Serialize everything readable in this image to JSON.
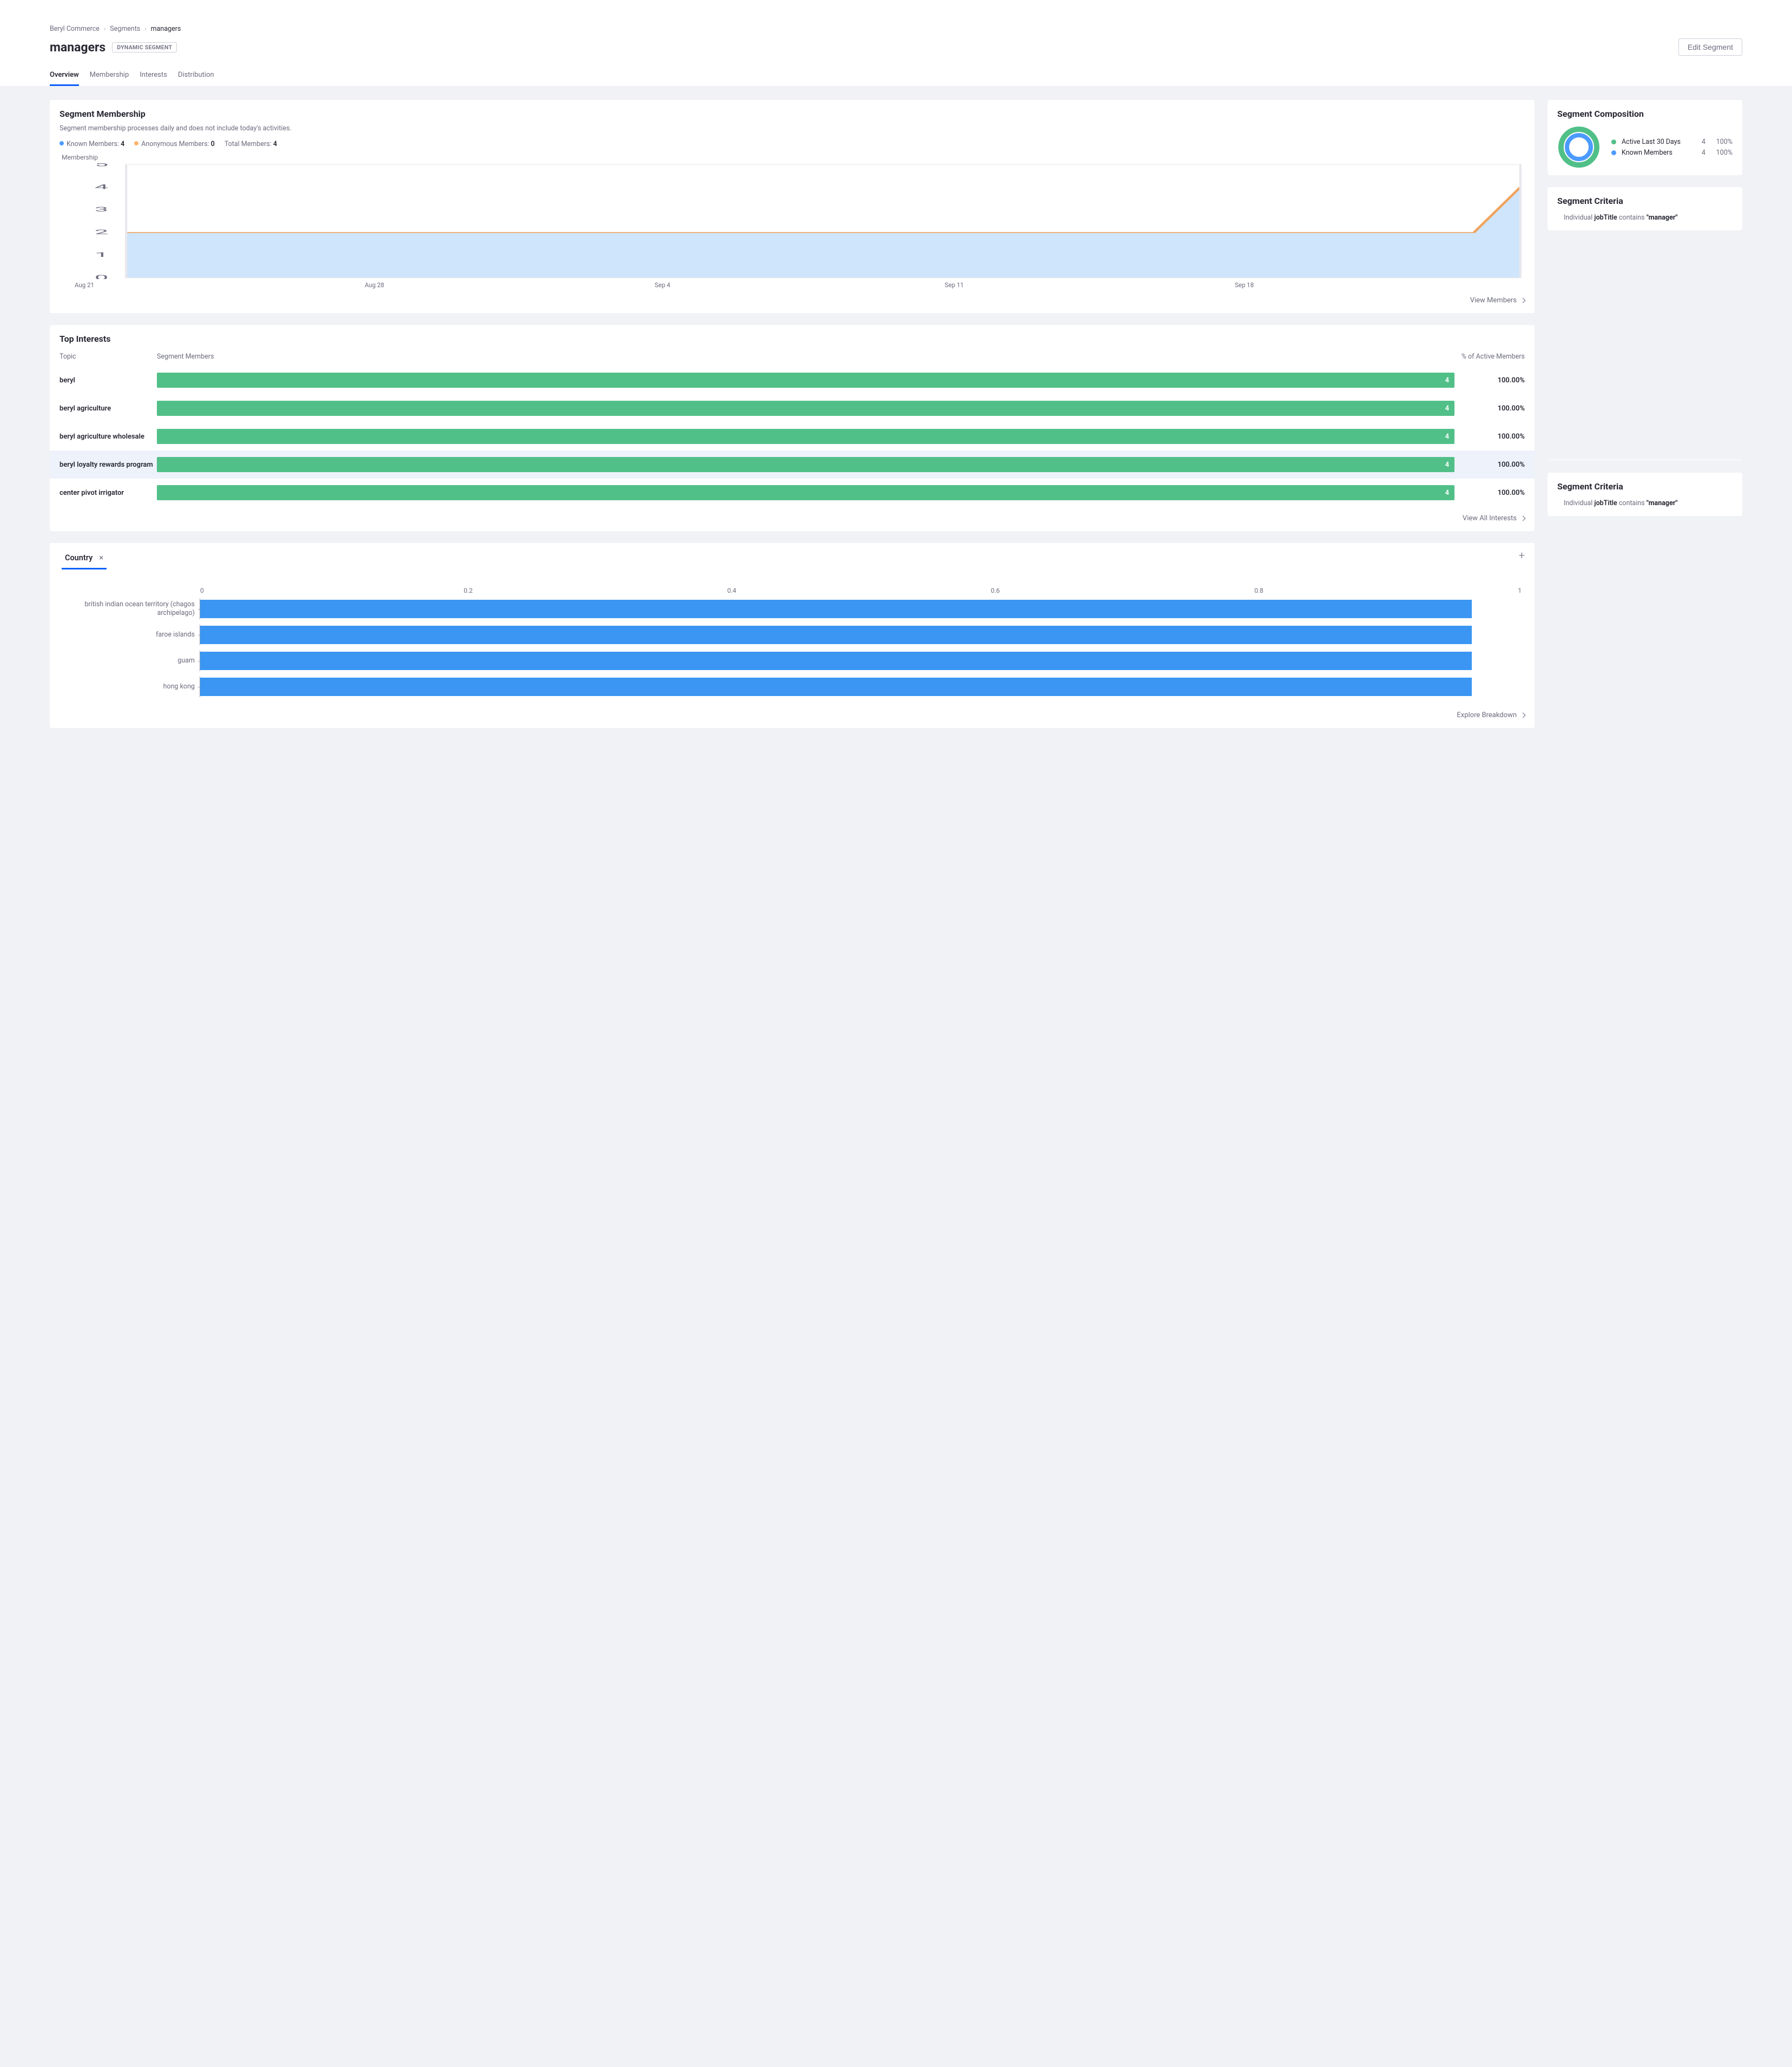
{
  "breadcrumb": {
    "root": "Beryl Commerce",
    "mid": "Segments",
    "current": "managers"
  },
  "title": "managers",
  "tag_label": "DYNAMIC SEGMENT",
  "edit_btn": "Edit Segment",
  "tabs": [
    {
      "id": "overview",
      "label": "Overview",
      "active": true
    },
    {
      "id": "membership",
      "label": "Membership",
      "active": false
    },
    {
      "id": "interests",
      "label": "Interests",
      "active": false
    },
    {
      "id": "distribution",
      "label": "Distribution",
      "active": false
    }
  ],
  "membership_card": {
    "title": "Segment Membership",
    "helper": "Segment membership processes daily and does not include today's activities.",
    "legend": {
      "known_label": "Known Members:",
      "known_value": "4",
      "known_color": "#4b9bff",
      "anon_label": "Anonymous Members:",
      "anon_value": "0",
      "anon_color": "#ffb46e",
      "total_label": "Total Members:",
      "total_value": "4"
    },
    "chart_title": "Membership",
    "view_members": "View Members"
  },
  "chart_data": {
    "membership_line": {
      "type": "area",
      "ylabel": "",
      "xlabel": "",
      "ylim": [
        0,
        5
      ],
      "yticks": [
        "0",
        "1",
        "2",
        "3",
        "4",
        "5"
      ],
      "xticks": [
        "Aug 21",
        "Aug 28",
        "Sep 4",
        "Sep 11",
        "Sep 18"
      ],
      "x": [
        0,
        1,
        2,
        3,
        4,
        5,
        6,
        7,
        8,
        9,
        10,
        11,
        12,
        13,
        14,
        15,
        16,
        17,
        18,
        19,
        20,
        21,
        22,
        23,
        24,
        25,
        26,
        27,
        28,
        29,
        30
      ],
      "values": [
        2,
        2,
        2,
        2,
        2,
        2,
        2,
        2,
        2,
        2,
        2,
        2,
        2,
        2,
        2,
        2,
        2,
        2,
        2,
        2,
        2,
        2,
        2,
        2,
        2,
        2,
        2,
        2,
        2,
        2,
        4
      ],
      "line_color": "#f0a35e",
      "fill_color": "#cfe5fb"
    },
    "country_bars": {
      "type": "bar",
      "orientation": "horizontal",
      "xlim": [
        0,
        1
      ],
      "xticks": [
        "0",
        "0.2",
        "0.4",
        "0.6",
        "0.8",
        "1"
      ],
      "categories": [
        "british indian ocean territory (chagos archipelago)",
        "faroe islands",
        "guam",
        "hong kong"
      ],
      "values": [
        1,
        1,
        1,
        1
      ],
      "color": "#3a96f2"
    },
    "composition_donut": {
      "type": "pie",
      "series": [
        {
          "name": "Active Last 30 Days",
          "value": 4,
          "percent": "100%",
          "color": "#51c088"
        },
        {
          "name": "Known Members",
          "value": 4,
          "percent": "100%",
          "color": "#4b9bff"
        }
      ]
    }
  },
  "interests_card": {
    "title": "Top Interests",
    "col_topic": "Topic",
    "col_seg": "Segment Members",
    "col_pct": "% of Active Members",
    "rows": [
      {
        "topic": "beryl",
        "count": "4",
        "pct": "100.00%",
        "hl": false
      },
      {
        "topic": "beryl agriculture",
        "count": "4",
        "pct": "100.00%",
        "hl": false
      },
      {
        "topic": "beryl agriculture wholesale",
        "count": "4",
        "pct": "100.00%",
        "hl": false
      },
      {
        "topic": "beryl loyalty rewards program",
        "count": "4",
        "pct": "100.00%",
        "hl": true
      },
      {
        "topic": "center pivot irrigator",
        "count": "4",
        "pct": "100.00%",
        "hl": false
      }
    ],
    "view_all": "View All Interests"
  },
  "distribution_card": {
    "tab_label": "Country",
    "explore": "Explore Breakdown"
  },
  "composition_card": {
    "title": "Segment Composition"
  },
  "criteria_card": {
    "title": "Segment Criteria",
    "entity": "Individual",
    "field": "jobTitle",
    "op": "contains",
    "value": "\"manager\""
  }
}
